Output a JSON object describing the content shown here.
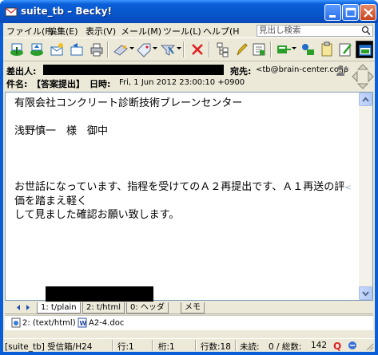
{
  "window": {
    "title": "suite_tb – Becky!"
  },
  "menu": {
    "items": [
      "ファイル(F)",
      "編集(E)",
      "表示(V)",
      "メール(M)",
      "ツール(L)",
      "ヘルプ(H"
    ],
    "search_placeholder": "見出し検索"
  },
  "toolbar": {
    "icons": [
      "get-mail-icon",
      "send-mail-icon",
      "compose-icon",
      "reply-icon",
      "print-icon",
      "forward-icon",
      "label-icon",
      "filter-icon",
      "delete-icon",
      "tree-icon",
      "edit-icon",
      "note-icon",
      "sort-icon",
      "address-book-icon",
      "clipboard-icon",
      "memo-edit-icon",
      "window-icon"
    ]
  },
  "header": {
    "from_label": "差出人:",
    "to_label": "宛先:",
    "to_value": "<tb@brain-center.co.jp",
    "subject_label": "件名:",
    "subject_value": "【答案提出】",
    "date_label": "日時:",
    "date_value": "Fri, 1 Jun 2012 23:00:10 +0900"
  },
  "body": {
    "lines": [
      "有限会社コンクリート診断技術ブレーンセンター",
      "",
      "浅野慎一　様　御中",
      "",
      "",
      "",
      "お世話になっています、指程を受けてのＡ２再提出です、Ａ１再送の評",
      "価を踏まえ軽く",
      "して見ました確認お願い致します。"
    ],
    "wrap_marker": "<"
  },
  "tabs": [
    {
      "label": "1: t/plain"
    },
    {
      "label": "2: t/html"
    },
    {
      "label": "0: ヘッダ"
    },
    {
      "label": "メモ"
    }
  ],
  "attachments": [
    {
      "label": "2: (text/html)",
      "icon": "html-file-icon"
    },
    {
      "label": "A2-4.doc",
      "icon": "word-doc-icon"
    }
  ],
  "status": {
    "folder": "[suite_tb] 受信箱/H24",
    "line": "行:1",
    "column": "桁:1",
    "line_count": "行数:18",
    "unread": "未読:",
    "unread_total": "0 / 総数:",
    "total": "142"
  },
  "colors": {
    "titlebar": "#0a5fd8",
    "chrome": "#ece9d8",
    "redaction": "#000000"
  }
}
